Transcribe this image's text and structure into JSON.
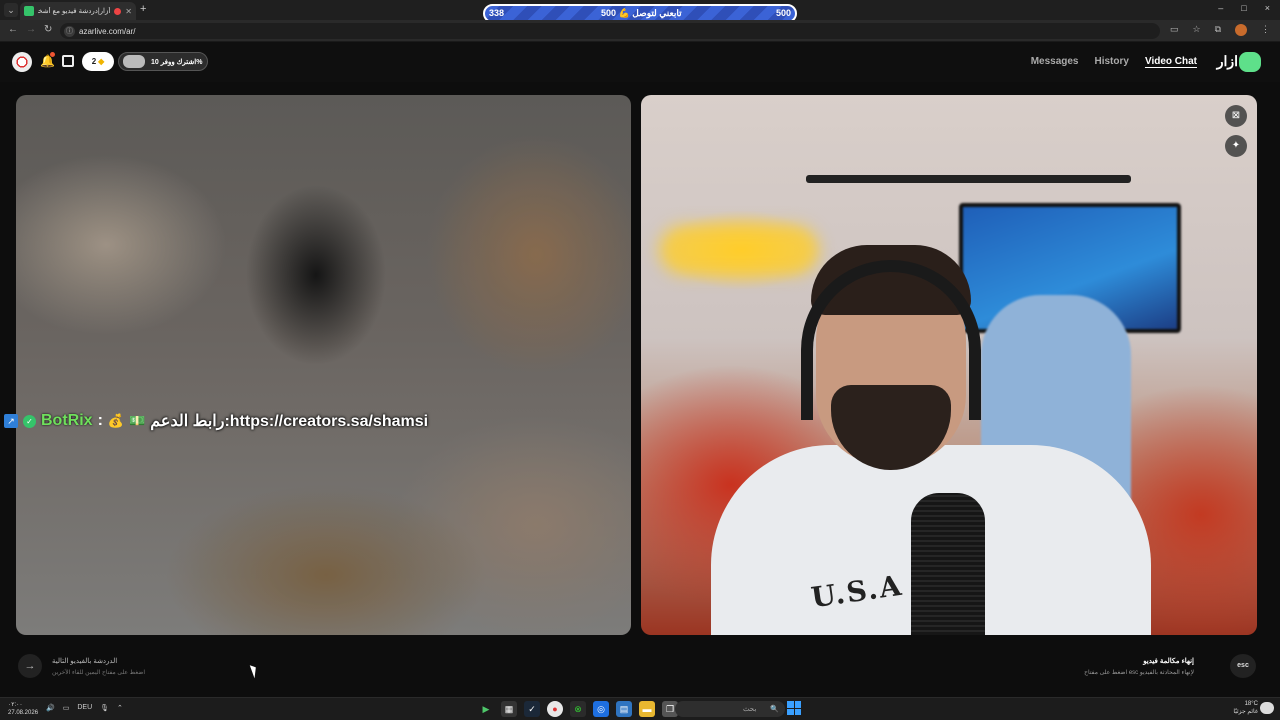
{
  "browser": {
    "tab_title": "أزار|دردشة فيديو مع أشخاص",
    "url": "azarlive.com/ar/",
    "window_controls": [
      "–",
      "□",
      "×"
    ]
  },
  "stream_goal": {
    "current": "338",
    "label": "تابعني لتوصل 💪 500",
    "target": "500"
  },
  "header": {
    "gem_count": "2",
    "subscription_label": "اشترك ووفر 10%",
    "nav": {
      "messages": "Messages",
      "history": "History",
      "video_chat": "Video Chat"
    },
    "logo_text": "ازار"
  },
  "video": {
    "shirt_text": "U.S.A"
  },
  "chat_overlay": {
    "username": "BotRix",
    "colon": ":",
    "emoji1": "💰",
    "emoji2": "💵",
    "message": "رابط الدعم:https://creators.sa/shamsi"
  },
  "bottom": {
    "next_title": "الدردشة بالفيديو التالية",
    "next_sub": "اضغط على مفتاح اليمين للقاء الآخرين",
    "end_title": "إنهاء مكالمة فيديو",
    "end_sub": "اضغط على مفتاح esc لإنهاء المحادثة بالفيديو",
    "esc_label": "esc"
  },
  "taskbar": {
    "time": "٠٢:٠٠",
    "date": "27.08.2026",
    "lang": "DEU",
    "search_placeholder": "بحث",
    "temperature": "18°C",
    "weather_desc": "غائم جزئيًا"
  },
  "colors": {
    "accent_green": "#5ee08a",
    "goal_blue": "#3b63d6",
    "overlay_name": "#6fe05c"
  }
}
